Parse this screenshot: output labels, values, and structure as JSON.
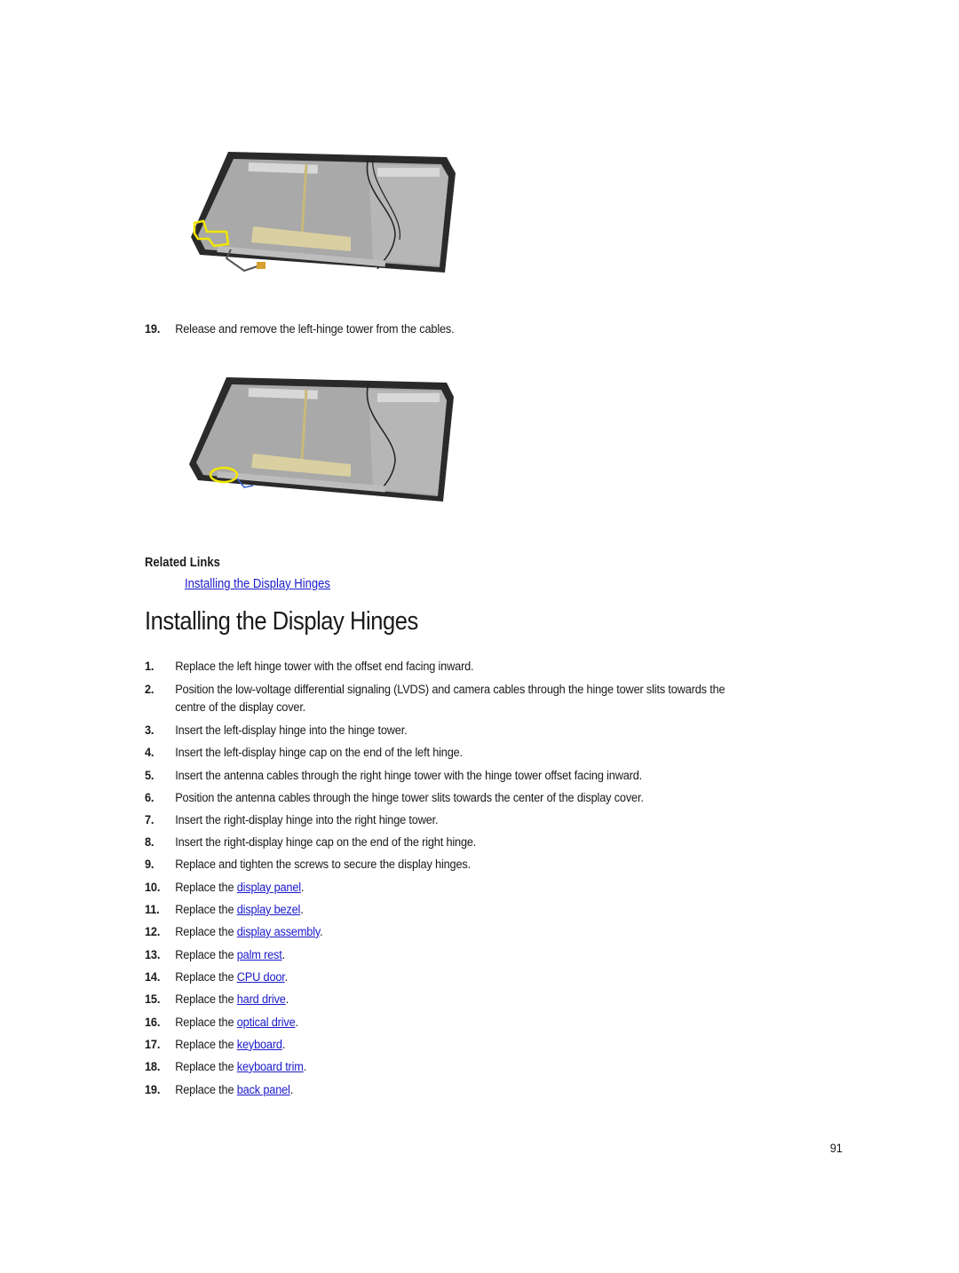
{
  "figures": [
    {
      "alt": "Display back cover with left-hinge tower and cable routing highlighted in yellow"
    },
    {
      "alt": "Display back cover with left-hinge tower removed, area highlighted in yellow"
    }
  ],
  "pre_step": {
    "number": "19.",
    "text": "Release and remove the left-hinge tower from the cables."
  },
  "related_links": {
    "title": "Related Links",
    "links": [
      "Installing the Display Hinges"
    ]
  },
  "section": {
    "title": "Installing the Display Hinges",
    "steps": [
      {
        "number": "1.",
        "text": "Replace the left hinge tower with the offset end facing inward."
      },
      {
        "number": "2.",
        "text": "Position the low-voltage differential signaling (LVDS) and camera cables through the hinge tower slits towards the",
        "cont": "centre of the display cover."
      },
      {
        "number": "3.",
        "text": "Insert the left-display hinge into the hinge tower."
      },
      {
        "number": "4.",
        "text": "Insert the left-display hinge cap on the end of the left hinge."
      },
      {
        "number": "5.",
        "text": "Insert the antenna cables through the right hinge tower with the hinge tower offset facing inward."
      },
      {
        "number": "6.",
        "text": "Position the antenna cables through the hinge tower slits towards the center of the display cover."
      },
      {
        "number": "7.",
        "text": "Insert the right-display hinge into the right hinge tower."
      },
      {
        "number": "8.",
        "text": "Insert the right-display hinge cap on the end of the right hinge."
      },
      {
        "number": "9.",
        "text": "Replace and tighten the screws to secure the display hinges."
      },
      {
        "number": "10.",
        "prefix": "Replace the ",
        "link": "display panel",
        "suffix": "."
      },
      {
        "number": "11.",
        "prefix": "Replace the ",
        "link": "display bezel",
        "suffix": "."
      },
      {
        "number": "12.",
        "prefix": "Replace the ",
        "link": "display assembly",
        "suffix": "."
      },
      {
        "number": "13.",
        "prefix": "Replace the ",
        "link": "palm rest",
        "suffix": "."
      },
      {
        "number": "14.",
        "prefix": "Replace the ",
        "link": "CPU door",
        "suffix": "."
      },
      {
        "number": "15.",
        "prefix": "Replace the ",
        "link": "hard drive",
        "suffix": "."
      },
      {
        "number": "16.",
        "prefix": "Replace the ",
        "link": "optical drive",
        "suffix": "."
      },
      {
        "number": "17.",
        "prefix": "Replace the ",
        "link": "keyboard",
        "suffix": "."
      },
      {
        "number": "18.",
        "prefix": "Replace the ",
        "link": "keyboard trim",
        "suffix": "."
      },
      {
        "number": "19.",
        "prefix": "Replace the ",
        "link": "back panel",
        "suffix": "."
      }
    ]
  },
  "page_number": "91",
  "colors": {
    "link": "#1a1acc",
    "highlight": "#f2e600"
  }
}
